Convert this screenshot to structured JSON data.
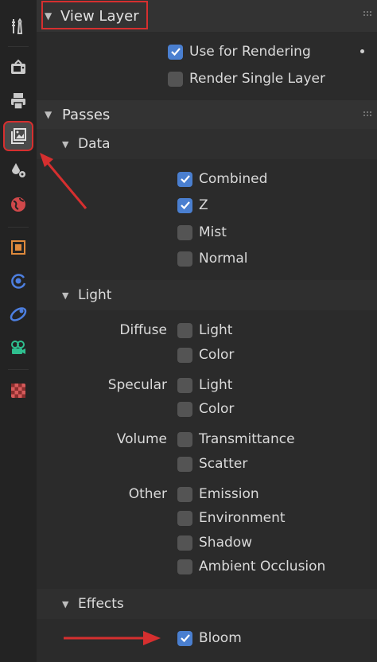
{
  "tabs": [
    {
      "icon": "tool-icon",
      "color": "#c9c9c9"
    },
    {
      "icon": "render-icon",
      "color": "#c9c9c9"
    },
    {
      "icon": "output-icon",
      "color": "#c9c9c9"
    },
    {
      "icon": "view-layer-icon",
      "color": "#e0e0e0",
      "active": true
    },
    {
      "icon": "scene-icon",
      "color": "#c9c9c9"
    },
    {
      "icon": "world-icon",
      "color": "#d0484a"
    },
    {
      "icon": "object-icon",
      "color": "#e08a3c"
    },
    {
      "icon": "physics-icon",
      "color": "#4d7fe0"
    },
    {
      "icon": "constraint-icon",
      "color": "#4d7fe0"
    },
    {
      "icon": "object-data-camera-icon",
      "color": "#2fbf8f"
    },
    {
      "icon": "texture-icon",
      "color": "#d65a5a"
    }
  ],
  "view_layer": {
    "title": "View Layer",
    "use_for_rendering": {
      "label": "Use for Rendering",
      "checked": true
    },
    "render_single_layer": {
      "label": "Render Single Layer",
      "checked": false
    }
  },
  "passes": {
    "title": "Passes",
    "data": {
      "title": "Data",
      "items": [
        {
          "label": "Combined",
          "checked": true
        },
        {
          "label": "Z",
          "checked": true
        },
        {
          "label": "Mist",
          "checked": false
        },
        {
          "label": "Normal",
          "checked": false
        }
      ]
    },
    "light": {
      "title": "Light",
      "groups": [
        {
          "label": "Diffuse",
          "items": [
            {
              "label": "Light",
              "checked": false
            },
            {
              "label": "Color",
              "checked": false
            }
          ]
        },
        {
          "label": "Specular",
          "items": [
            {
              "label": "Light",
              "checked": false
            },
            {
              "label": "Color",
              "checked": false
            }
          ]
        },
        {
          "label": "Volume",
          "items": [
            {
              "label": "Transmittance",
              "checked": false
            },
            {
              "label": "Scatter",
              "checked": false
            }
          ]
        },
        {
          "label": "Other",
          "items": [
            {
              "label": "Emission",
              "checked": false
            },
            {
              "label": "Environment",
              "checked": false
            },
            {
              "label": "Shadow",
              "checked": false
            },
            {
              "label": "Ambient Occlusion",
              "checked": false
            }
          ]
        }
      ]
    },
    "effects": {
      "title": "Effects",
      "items": [
        {
          "label": "Bloom",
          "checked": true
        }
      ]
    }
  },
  "colors": {
    "accent": "#4a7fd0",
    "annotation": "#d62f2f"
  }
}
